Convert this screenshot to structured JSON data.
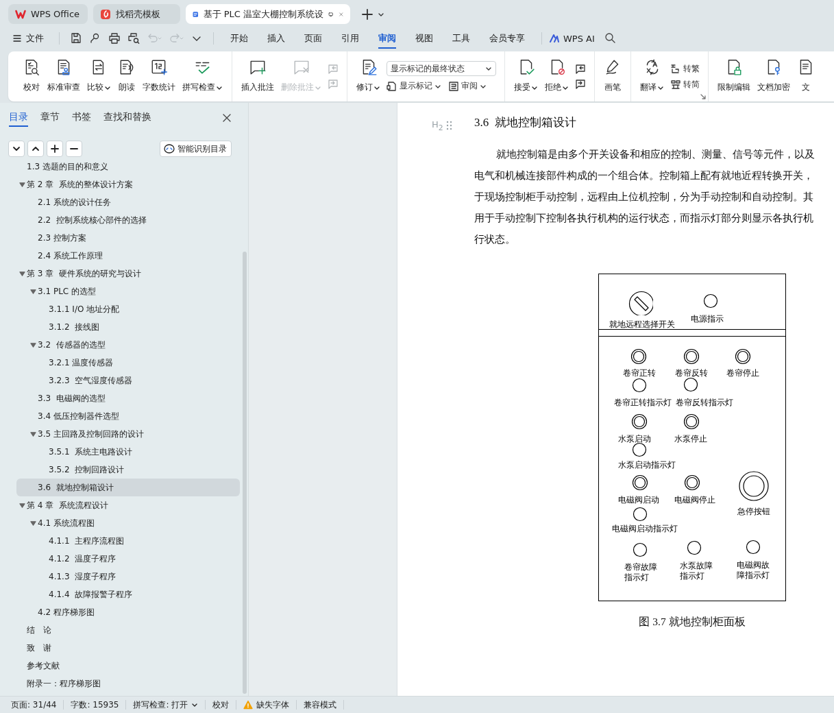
{
  "tabs": [
    {
      "label": "WPS Office",
      "kind": "wps",
      "selected": false
    },
    {
      "label": "找稻壳模板",
      "kind": "docer",
      "selected": false
    },
    {
      "label": "基于 PLC 温室大棚控制系统设",
      "kind": "doc",
      "selected": true
    }
  ],
  "menubar": {
    "file": "文件",
    "quick_tools": [
      {
        "kind": "save",
        "disabled": false
      },
      {
        "kind": "export",
        "disabled": false
      },
      {
        "kind": "print",
        "disabled": false
      },
      {
        "kind": "preview",
        "disabled": false
      },
      {
        "kind": "undo",
        "disabled": true
      },
      {
        "kind": "redo",
        "disabled": true
      },
      {
        "kind": "more",
        "disabled": false
      }
    ],
    "menu_tabs": [
      {
        "label": "开始",
        "selected": false
      },
      {
        "label": "插入",
        "selected": false
      },
      {
        "label": "页面",
        "selected": false
      },
      {
        "label": "引用",
        "selected": false
      },
      {
        "label": "审阅",
        "selected": true
      },
      {
        "label": "视图",
        "selected": false
      },
      {
        "label": "工具",
        "selected": false
      },
      {
        "label": "会员专享",
        "selected": false
      }
    ],
    "ai": "WPS AI"
  },
  "ribbon": {
    "groups": [
      {
        "items": [
          {
            "kind": "big",
            "label": "校对",
            "dropdown": false,
            "disabled": false
          },
          {
            "kind": "big",
            "label": "标准审查",
            "dropdown": false,
            "disabled": false
          },
          {
            "kind": "big",
            "label": "比较",
            "dropdown": true,
            "disabled": false
          },
          {
            "kind": "big",
            "label": "朗读",
            "dropdown": false,
            "disabled": false
          },
          {
            "kind": "big",
            "label": "字数统计",
            "dropdown": false,
            "disabled": false
          },
          {
            "kind": "big",
            "label": "拼写检查",
            "dropdown": true,
            "disabled": false
          }
        ]
      },
      {
        "items": [
          {
            "kind": "big",
            "label": "插入批注",
            "dropdown": false,
            "disabled": false
          },
          {
            "kind": "big",
            "label": "删除批注",
            "dropdown": true,
            "disabled": true
          },
          {
            "kind": "column",
            "items": [
              {
                "kind": "icon",
                "disabled": true
              },
              {
                "kind": "icon",
                "disabled": true
              }
            ]
          }
        ]
      },
      {
        "items": [
          {
            "kind": "big",
            "label": "修订",
            "dropdown": true,
            "disabled": false
          },
          {
            "kind": "column",
            "items": [
              {
                "kind": "select",
                "value": "显示标记的最终状态"
              },
              {
                "kind": "row",
                "items": [
                  {
                    "kind": "small",
                    "label": "显示标记",
                    "dropdown": true,
                    "disabled": false
                  },
                  {
                    "kind": "small",
                    "label": "审阅",
                    "dropdown": true,
                    "disabled": false
                  }
                ]
              }
            ]
          }
        ]
      },
      {
        "items": [
          {
            "kind": "big",
            "label": "接受",
            "dropdown": true,
            "disabled": false
          },
          {
            "kind": "big",
            "label": "拒绝",
            "dropdown": true,
            "disabled": false
          },
          {
            "kind": "column",
            "items": [
              {
                "kind": "icon",
                "disabled": false
              },
              {
                "kind": "icon",
                "disabled": false
              }
            ]
          }
        ]
      },
      {
        "items": [
          {
            "kind": "big",
            "label": "画笔",
            "dropdown": false,
            "disabled": false
          }
        ]
      },
      {
        "launcher": true,
        "items": [
          {
            "kind": "big",
            "label": "翻译",
            "dropdown": true,
            "disabled": false
          },
          {
            "kind": "column",
            "items": [
              {
                "kind": "small",
                "label": "转繁",
                "dropdown": false,
                "disabled": false
              },
              {
                "kind": "small",
                "label": "转简",
                "dropdown": false,
                "disabled": false
              }
            ]
          }
        ]
      },
      {
        "items": [
          {
            "kind": "big",
            "label": "限制编辑",
            "dropdown": false,
            "disabled": false
          },
          {
            "kind": "big",
            "label": "文档加密",
            "dropdown": false,
            "disabled": false
          },
          {
            "kind": "big",
            "label": "文",
            "dropdown": false,
            "disabled": false
          }
        ]
      }
    ]
  },
  "sidebar": {
    "tabs": [
      {
        "label": "目录",
        "selected": true
      },
      {
        "label": "章节",
        "selected": false
      },
      {
        "label": "书签",
        "selected": false
      },
      {
        "label": "查找和替换",
        "selected": false
      }
    ],
    "smart_button": "智能识别目录",
    "toc": [
      {
        "label": "1.3 选题的目的和意义",
        "selected": false
      },
      {
        "label": "第 2 章  系统的整体设计方案",
        "expanded": true,
        "selected": false,
        "children": [
          {
            "label": "2.1 系统的设计任务",
            "selected": false
          },
          {
            "label": "2.2  控制系统核心部件的选择",
            "selected": false
          },
          {
            "label": "2.3 控制方案",
            "selected": false
          },
          {
            "label": "2.4 系统工作原理",
            "selected": false
          }
        ]
      },
      {
        "label": "第 3 章  硬件系统的研究与设计",
        "expanded": true,
        "selected": false,
        "children": [
          {
            "label": "3.1 PLC 的选型",
            "expanded": true,
            "selected": false,
            "children": [
              {
                "label": "3.1.1 I/O 地址分配",
                "selected": false
              },
              {
                "label": "3.1.2  接线图",
                "selected": false
              }
            ]
          },
          {
            "label": "3.2  传感器的选型",
            "expanded": true,
            "selected": false,
            "children": [
              {
                "label": "3.2.1 温度传感器",
                "selected": false
              },
              {
                "label": "3.2.3  空气湿度传感器",
                "selected": false
              }
            ]
          },
          {
            "label": "3.3  电磁阀的选型",
            "selected": false
          },
          {
            "label": "3.4 低压控制器件选型",
            "selected": false
          },
          {
            "label": "3.5 主回路及控制回路的设计",
            "expanded": true,
            "selected": false,
            "children": [
              {
                "label": "3.5.1  系统主电路设计",
                "selected": false
              },
              {
                "label": "3.5.2  控制回路设计",
                "selected": false
              }
            ]
          },
          {
            "label": "3.6  就地控制箱设计",
            "selected": true
          }
        ]
      },
      {
        "label": "第 4 章  系统流程设计",
        "expanded": true,
        "selected": false,
        "children": [
          {
            "label": "4.1 系统流程图",
            "expanded": true,
            "selected": false,
            "children": [
              {
                "label": "4.1.1  主程序流程图",
                "selected": false
              },
              {
                "label": "4.1.2  温度子程序",
                "selected": false
              },
              {
                "label": "4.1.3  湿度子程序",
                "selected": false
              },
              {
                "label": "4.1.4  故障报警子程序",
                "selected": false
              }
            ]
          },
          {
            "label": "4.2 程序梯形图",
            "selected": false
          }
        ]
      },
      {
        "label": "结　论",
        "selected": false
      },
      {
        "label": "致　谢",
        "selected": false
      },
      {
        "label": "参考文献",
        "selected": false
      },
      {
        "label": "附录一：程序梯形图",
        "selected": false
      }
    ]
  },
  "document": {
    "style_marker": "H$_{2}$",
    "heading": {
      "number": "3.6",
      "title": "就地控制箱设计"
    },
    "paragraph_lines": [
      "就地控制箱是由多个开关设备和相应的控制、测量、信号等元件，以及",
      "电气和机械连接部件构成的一个组合体。控制箱上配有就地近程转换开关，",
      "于现场控制柜手动控制，远程由上位机控制，分为手动控制和自动控制。其",
      "用于手动控制下控制各执行机构的运行状态，而指示灯部分则显示各执行机",
      "行状态。"
    ],
    "figure": {
      "controls": [
        {
          "label": "就地远程选择开关",
          "kind": "selector"
        },
        {
          "label": "电源指示",
          "kind": "lamp"
        },
        {
          "label": "卷帘正转",
          "kind": "button"
        },
        {
          "label": "卷帘反转",
          "kind": "button"
        },
        {
          "label": "卷帘停止",
          "kind": "button"
        },
        {
          "label": "卷帘正转指示灯",
          "kind": "lamp"
        },
        {
          "label": "卷帘反转指示灯",
          "kind": "lamp"
        },
        {
          "label": "水泵启动",
          "kind": "button"
        },
        {
          "label": "水泵停止",
          "kind": "button"
        },
        {
          "label": "水泵启动指示灯",
          "kind": "lamp"
        },
        {
          "label": "电磁阀启动",
          "kind": "button"
        },
        {
          "label": "电磁阀停止",
          "kind": "button"
        },
        {
          "label": "急停按钮",
          "kind": "estop"
        },
        {
          "label": "电磁阀启动指示灯",
          "kind": "lamp"
        },
        {
          "label": "卷帘故障指示灯",
          "kind": "lamp"
        },
        {
          "label": "水泵故障指示灯",
          "kind": "lamp"
        },
        {
          "label": "电磁阀故障指示灯",
          "kind": "lamp"
        }
      ],
      "caption": "图 3.7 就地控制柜面板"
    }
  },
  "status_bar": {
    "items": [
      {
        "label": "页面: 31/44",
        "kind": "text"
      },
      {
        "label": "字数: 15935",
        "kind": "text"
      },
      {
        "label": "拼写检查: 打开",
        "kind": "dropdown"
      },
      {
        "label": "校对",
        "kind": "text"
      },
      {
        "label": "缺失字体",
        "kind": "warning"
      },
      {
        "label": "兼容模式",
        "kind": "text"
      }
    ]
  }
}
